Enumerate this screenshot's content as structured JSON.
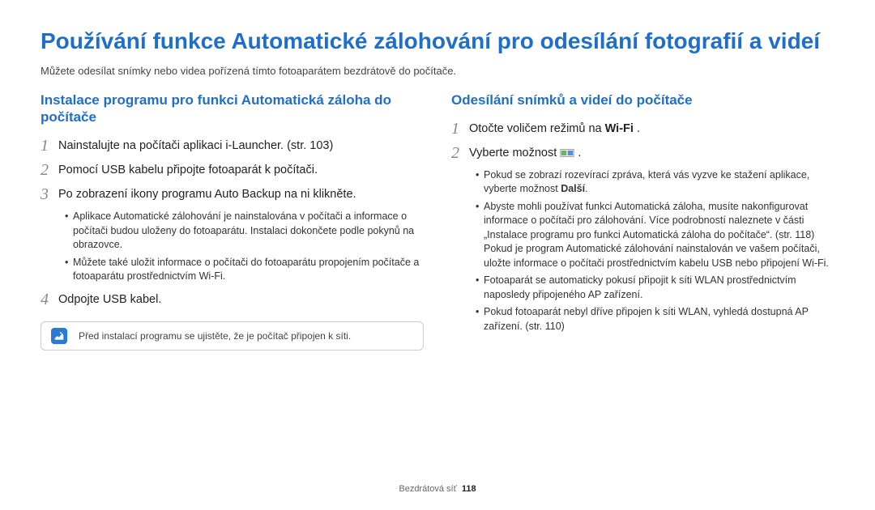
{
  "title": "Používání funkce Automatické zálohování pro odesílání fotografií a videí",
  "intro": "Můžete odesílat snímky nebo videa pořízená tímto fotoaparátem bezdrátově do počítače.",
  "left": {
    "heading": "Instalace programu pro funkci Automatická záloha do počítače",
    "s1": "Nainstalujte na počítači aplikaci i-Launcher. (str. 103)",
    "s2": "Pomocí USB kabelu připojte fotoaparát k počítači.",
    "s3": "Po zobrazení ikony programu Auto Backup na ni klikněte.",
    "s3b1": "Aplikace Automatické zálohování je nainstalována v počítači a informace o počítači budou uloženy do fotoaparátu. Instalaci dokončete podle pokynů na obrazovce.",
    "s3b2": "Můžete také uložit informace o počítači do fotoaparátu propojením počítače a fotoaparátu prostřednictvím Wi-Fi.",
    "s4": "Odpojte USB kabel.",
    "note": "Před instalací programu se ujistěte, že je počítač připojen k síti."
  },
  "right": {
    "heading": "Odesílání snímků a videí do počítače",
    "s1_pre": "Otočte voličem režimů na ",
    "s1_wifi": "Wi-Fi",
    "s2": "Vyberte možnost ",
    "b1_pre": "Pokud se zobrazí rozevírací zpráva, která vás vyzve ke stažení aplikace, vyberte možnost ",
    "b1_bold": "Další",
    "b2": "Abyste mohli používat funkci Automatická záloha, musíte nakonfigurovat informace o počítači pro zálohování. Více podrobností naleznete v části „Instalace programu pro funkci Automatická záloha do počítače“. (str. 118) Pokud je program Automatické zálohování nainstalován ve vašem počítači, uložte informace o počítači prostřednictvím kabelu USB nebo připojení Wi-Fi.",
    "b3": "Fotoaparát se automaticky pokusí připojit k síti WLAN prostřednictvím naposledy připojeného AP zařízení.",
    "b4": "Pokud fotoaparát nebyl dříve připojen k síti WLAN, vyhledá dostupná AP zařízení. (str. 110)"
  },
  "footer": {
    "section": "Bezdrátová síť",
    "page": "118"
  },
  "nums": {
    "n1": "1",
    "n2": "2",
    "n3": "3",
    "n4": "4"
  }
}
